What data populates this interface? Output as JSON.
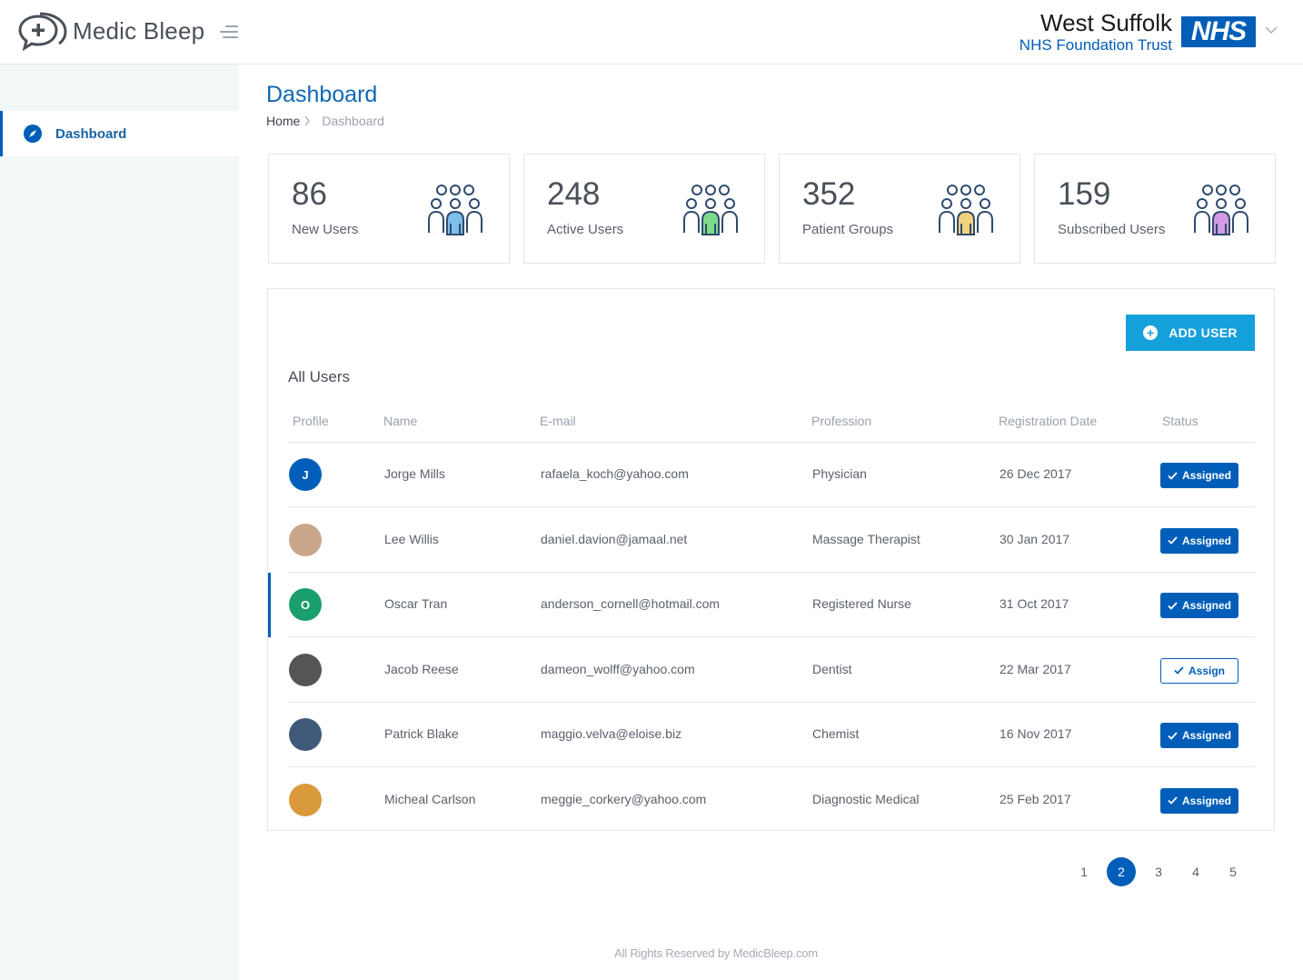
{
  "app": {
    "name": "Medic Bleep"
  },
  "trust": {
    "name": "West Suffolk",
    "subtitle": "NHS Foundation Trust",
    "badge": "NHS"
  },
  "sidebar": {
    "items": [
      {
        "label": "Dashboard",
        "icon": "compass-icon",
        "active": true
      }
    ]
  },
  "page": {
    "title": "Dashboard"
  },
  "breadcrumb": {
    "home": "Home",
    "current": "Dashboard"
  },
  "stats": [
    {
      "value": "86",
      "label": "New Users",
      "color": "#7fbfea"
    },
    {
      "value": "248",
      "label": "Active Users",
      "color": "#7ddc8a"
    },
    {
      "value": "352",
      "label": "Patient Groups",
      "color": "#f1d27a"
    },
    {
      "value": "159",
      "label": "Subscribed Users",
      "color": "#d59ae6"
    }
  ],
  "users_table": {
    "add_button": "ADD USER",
    "title": "All Users",
    "columns": [
      "Profile",
      "Name",
      "E-mail",
      "Profession",
      "Registration Date",
      "Status"
    ],
    "rows": [
      {
        "initial": "J",
        "avatar_color": "#005eb8",
        "name": "Jorge Mills",
        "email": "rafaela_koch@yahoo.com",
        "profession": "Physician",
        "date": "26 Dec 2017",
        "status": "Assigned"
      },
      {
        "initial": "",
        "avatar_color": "#c9a58a",
        "name": "Lee Willis",
        "email": "daniel.davion@jamaal.net",
        "profession": "Massage Therapist",
        "date": "30 Jan 2017",
        "status": "Assigned"
      },
      {
        "initial": "O",
        "avatar_color": "#1a9e6e",
        "name": "Oscar Tran",
        "email": "anderson_cornell@hotmail.com",
        "profession": "Registered Nurse",
        "date": "31 Oct 2017",
        "status": "Assigned"
      },
      {
        "initial": "",
        "avatar_color": "#555555",
        "name": "Jacob Reese",
        "email": "dameon_wolff@yahoo.com",
        "profession": "Dentist",
        "date": "22 Mar 2017",
        "status": "Assign"
      },
      {
        "initial": "",
        "avatar_color": "#3f5a78",
        "name": "Patrick Blake",
        "email": "maggio.velva@eloise.biz",
        "profession": "Chemist",
        "date": "16 Nov 2017",
        "status": "Assigned"
      },
      {
        "initial": "",
        "avatar_color": "#d89a3a",
        "name": "Micheal Carlson",
        "email": "meggie_corkery@yahoo.com",
        "profession": "Diagnostic Medical",
        "date": "25 Feb 2017",
        "status": "Assigned"
      }
    ]
  },
  "pagination": {
    "pages": [
      "1",
      "2",
      "3",
      "4",
      "5"
    ],
    "current": "2"
  },
  "footer": {
    "text": "All Rights Reserved by MedicBleep.com"
  }
}
